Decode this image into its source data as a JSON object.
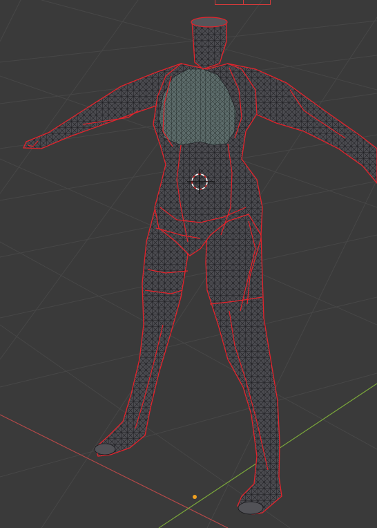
{
  "app": {
    "type": "3d-viewport",
    "mode": "Edit Mode"
  },
  "viewport": {
    "background_color": "#3a3a3a",
    "grid_color": "#474747",
    "x_axis_color": "#b44848",
    "y_axis_color": "#7aa63a",
    "origin_marker_color": "#f0a020"
  },
  "object": {
    "name_icon": "mannequin-mesh",
    "fill_color": "#4b4b50",
    "chest_fill_color": "#5c6b6a",
    "wire_color": "#16161a",
    "seam_color": "#e4232b"
  },
  "cursor": {
    "icon": "3d-cursor-icon",
    "ring_colors": [
      "#ffffff",
      "#d22a2a"
    ]
  },
  "header_tab": {
    "icon": "header-tab-icon"
  }
}
